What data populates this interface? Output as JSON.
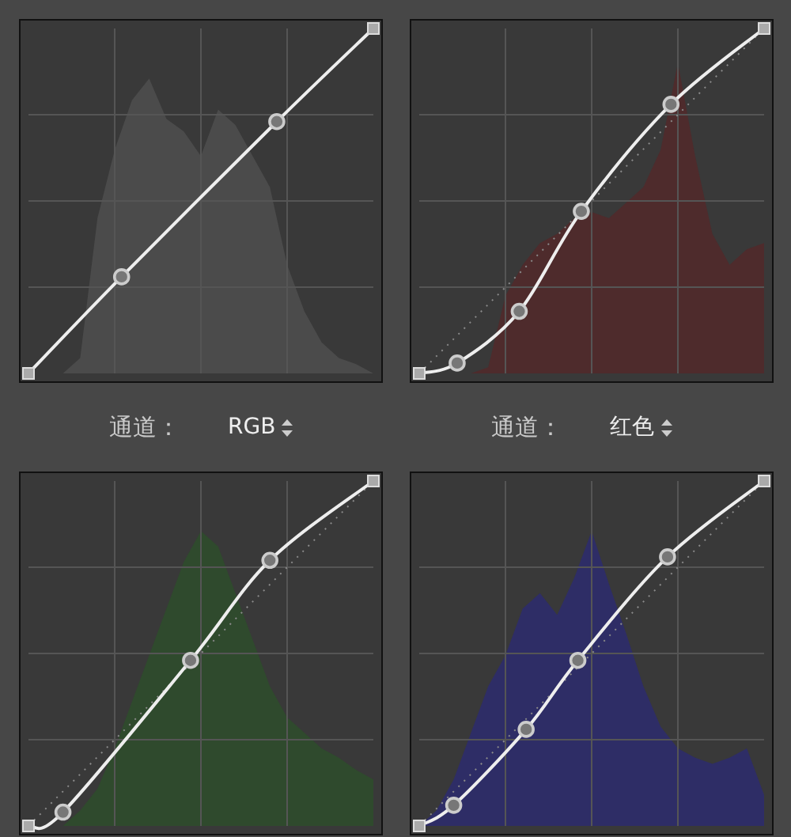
{
  "panels": [
    {
      "kind": "rgb"
    },
    {
      "kind": "red"
    },
    {
      "kind": "green"
    },
    {
      "kind": "blue"
    }
  ],
  "channel_selectors": [
    {
      "label": "通道：",
      "value": "RGB"
    },
    {
      "label": "通道：",
      "value": "红色"
    }
  ]
}
